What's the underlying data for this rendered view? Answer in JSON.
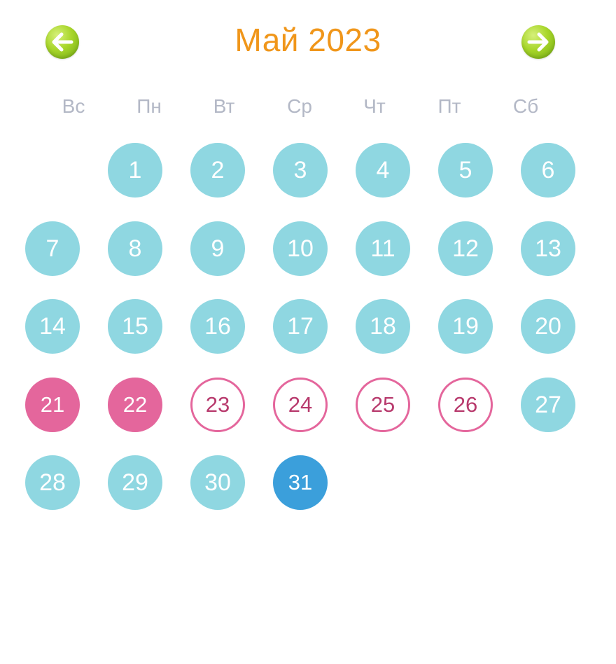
{
  "header": {
    "title": "Май 2023",
    "prev_icon": "arrow-left-icon",
    "next_icon": "arrow-right-icon"
  },
  "weekdays": [
    "Вс",
    "Пн",
    "Вт",
    "Ср",
    "Чт",
    "Пт",
    "Сб"
  ],
  "colors": {
    "title": "#f0961a",
    "weekday": "#b3b8c6",
    "regular_day": "#8fd7e1",
    "period_day": "#e4669c",
    "predicted_day_outline": "#e4669c",
    "predicted_day_text": "#b83a6d",
    "today": "#3b9fdb",
    "nav_button": "#a8d62a"
  },
  "calendar": {
    "first_day_column": 1,
    "days": [
      {
        "label": "1",
        "state": "regular"
      },
      {
        "label": "2",
        "state": "regular"
      },
      {
        "label": "3",
        "state": "regular"
      },
      {
        "label": "4",
        "state": "regular"
      },
      {
        "label": "5",
        "state": "regular"
      },
      {
        "label": "6",
        "state": "regular"
      },
      {
        "label": "7",
        "state": "regular"
      },
      {
        "label": "8",
        "state": "regular"
      },
      {
        "label": "9",
        "state": "regular"
      },
      {
        "label": "10",
        "state": "regular"
      },
      {
        "label": "11",
        "state": "regular"
      },
      {
        "label": "12",
        "state": "regular"
      },
      {
        "label": "13",
        "state": "regular"
      },
      {
        "label": "14",
        "state": "regular"
      },
      {
        "label": "15",
        "state": "regular"
      },
      {
        "label": "16",
        "state": "regular"
      },
      {
        "label": "17",
        "state": "regular"
      },
      {
        "label": "18",
        "state": "regular"
      },
      {
        "label": "19",
        "state": "regular"
      },
      {
        "label": "20",
        "state": "regular"
      },
      {
        "label": "21",
        "state": "pink-filled"
      },
      {
        "label": "22",
        "state": "pink-filled"
      },
      {
        "label": "23",
        "state": "pink-outline"
      },
      {
        "label": "24",
        "state": "pink-outline"
      },
      {
        "label": "25",
        "state": "pink-outline"
      },
      {
        "label": "26",
        "state": "pink-outline"
      },
      {
        "label": "27",
        "state": "regular"
      },
      {
        "label": "28",
        "state": "regular"
      },
      {
        "label": "29",
        "state": "regular"
      },
      {
        "label": "30",
        "state": "regular"
      },
      {
        "label": "31",
        "state": "today"
      }
    ]
  }
}
